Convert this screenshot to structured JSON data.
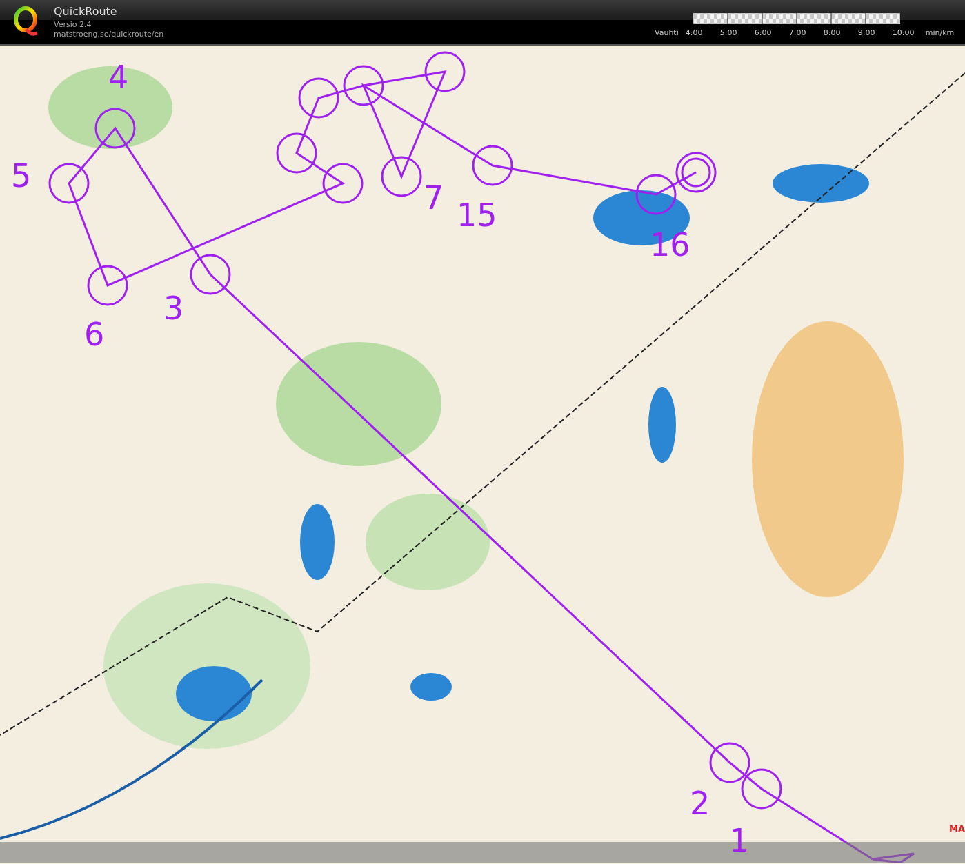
{
  "header": {
    "app_name": "QuickRoute",
    "version": "Versio 2.4",
    "url": "matstroeng.se/quickroute/en"
  },
  "pace_scale": {
    "label": "Vauhti",
    "ticks": [
      "4:00",
      "5:00",
      "6:00",
      "7:00",
      "8:00",
      "9:00",
      "10:00"
    ],
    "unit": "min/km"
  },
  "map": {
    "control_numbers": [
      "4",
      "5",
      "3",
      "6",
      "7",
      "15",
      "16",
      "2",
      "1"
    ],
    "map_label": "MA"
  }
}
